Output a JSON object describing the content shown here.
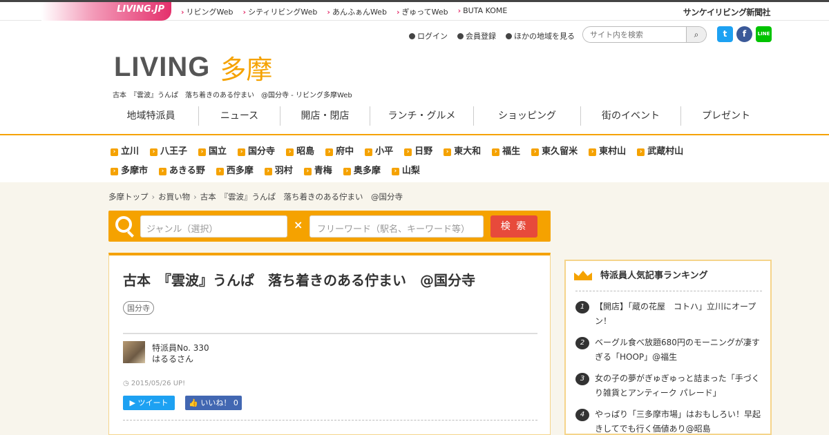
{
  "topbar": {
    "logo": "LIVING.JP",
    "links": [
      "リビングWeb",
      "シティリビングWeb",
      "あんふぁんWeb",
      "ぎゅってWeb",
      "BUTA KOME"
    ],
    "corp": "サンケイリビング新聞社"
  },
  "header": {
    "utils": [
      "ログイン",
      "会員登録",
      "ほかの地域を見る"
    ],
    "search_placeholder": "サイト内を検索",
    "brand_main": "LIVING",
    "brand_region": "多摩",
    "subtitle": "古本　『雲波』うんぱ　落ち着きのある佇まい　@国分寺 - リビング多摩Web",
    "sns": [
      "twitter-icon",
      "facebook-icon",
      "line-icon"
    ],
    "nav": [
      "地域特派員",
      "ニュース",
      "開店・閉店",
      "ランチ・グルメ",
      "ショッピング",
      "街のイベント",
      "プレゼント"
    ]
  },
  "areas": {
    "row1": [
      "立川",
      "八王子",
      "国立",
      "国分寺",
      "昭島",
      "府中",
      "小平",
      "日野",
      "東大和",
      "福生",
      "東久留米",
      "東村山",
      "武蔵村山"
    ],
    "row2": [
      "多摩市",
      "あきる野",
      "西多摩",
      "羽村",
      "青梅",
      "奥多摩",
      "山梨"
    ]
  },
  "breadcrumb": [
    "多摩トップ",
    "お買い物",
    "古本　『雲波』うんぱ　落ち着きのある佇まい　@国分寺"
  ],
  "searchbar": {
    "genre_placeholder": "ジャンル（選択）",
    "times": "×",
    "free_placeholder": "フリーワード（駅名、キーワード等）",
    "button": "検 索"
  },
  "article": {
    "title": "古本　『雲波』うんぱ　落ち着きのある佇まい　@国分寺",
    "tag": "国分寺",
    "author_no": "特派員No. 330",
    "author_name": "はるるさん",
    "date": "2015/05/26 UP!",
    "tweet": "ツイート",
    "like": "いいね！ 0"
  },
  "ranking": {
    "title": "特派員人気記事ランキング",
    "items": [
      {
        "n": "1",
        "text": "【開店】「蔵の花屋　コトハ」立川にオープン！"
      },
      {
        "n": "2",
        "text": "ベーグル食べ放題680円のモーニングが凄すぎる「HOOP」@福生"
      },
      {
        "n": "3",
        "text": "女の子の夢がぎゅぎゅっと詰まった「手づくり雑貨とアンティーク パレード」"
      },
      {
        "n": "4",
        "text": "やっぱり「三多摩市場」はおもしろい！早起きしてでも行く価値あり@昭島"
      }
    ]
  }
}
